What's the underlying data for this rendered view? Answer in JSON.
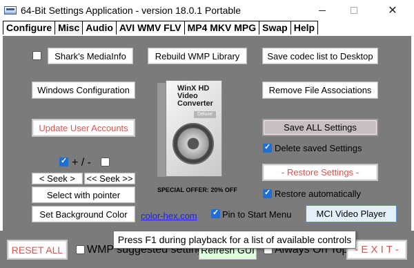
{
  "window": {
    "title": "64-Bit Settings Application - version 18.0.1 Portable",
    "min_symbol": "",
    "close_symbol": "✕"
  },
  "tabs": [
    "Configure",
    "Misc",
    "Audio",
    "AVI WMV FLV",
    "MP4 MKV MPG",
    "Swap",
    "Help"
  ],
  "active_tab": "Misc",
  "buttons": {
    "sharks_mediainfo": "Shark's MediaInfo",
    "rebuild_wmp": "Rebuild WMP Library",
    "save_codec_list": "Save codec list to Desktop",
    "windows_config": "Windows Configuration",
    "remove_file_assoc": "Remove File Associations",
    "update_user_accounts": "Update User Accounts",
    "save_all_settings": "Save ALL Settings",
    "restore_settings": "- Restore Settings -",
    "seek_back": "<  Seek  >",
    "seek_fwd": "<< Seek >>",
    "select_with_pointer": "Select with pointer",
    "set_bg_color": "Set Background Color",
    "mci_video_player": "MCI Video Player",
    "reset_all": "RESET ALL",
    "refresh_gui": "Refresh GUI",
    "exit": "- E X I T -"
  },
  "checkboxes": {
    "sharks_mediainfo": false,
    "plus": true,
    "minus": false,
    "delete_saved": true,
    "restore_auto": true,
    "pin_start": true,
    "wmp_suggested": false,
    "always_on_top": false
  },
  "labels": {
    "plus_minus": "+ / -",
    "delete_saved": "Delete saved Settings",
    "restore_auto": "Restore automatically",
    "pin_start": "Pin to Start Menu",
    "color_hex": "color-hex.com",
    "wmp_suggested": "WMP suggested settings",
    "always_on_top": "Always On Top"
  },
  "product": {
    "title_line1": "WinX HD",
    "title_line2": "Video Converter",
    "badge": "Deluxe",
    "offer": "SPECIAL OFFER: 20% OFF"
  },
  "tooltip": "Press F1 during playback for a list of available controls",
  "colors": {
    "panel_bg": "#7b7b7b",
    "accent_blue": "#1e6ed4",
    "red_text": "#d9534f",
    "link": "#1a1aff"
  }
}
